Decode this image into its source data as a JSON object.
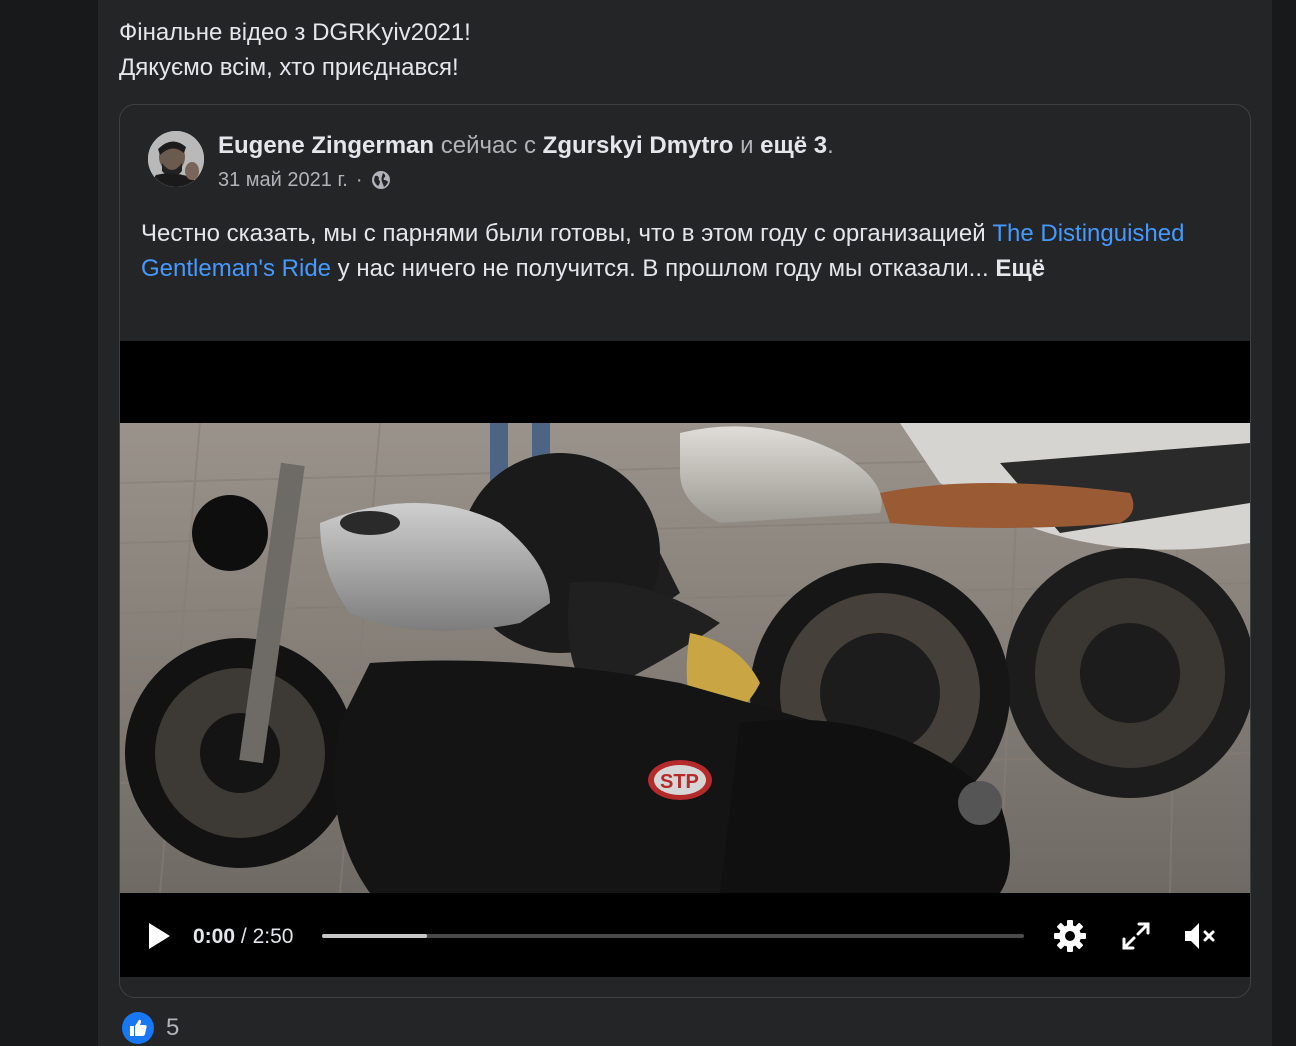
{
  "post": {
    "caption_line1": "Фінальне відео з DGRKyiv2021!",
    "caption_line2": "Дякуємо всім, хто приєднався!",
    "reaction_count": "5"
  },
  "shared_post": {
    "author": "Eugene Zingerman",
    "activity": "сейчас с",
    "tagged": "Zgurskyi Dmytro",
    "and_word": "и",
    "others": "ещё 3",
    "period": ".",
    "date": "31 май 2021 г.",
    "separator": "·",
    "privacy_icon": "globe-icon",
    "text_before_link": "Честно сказать, мы с парнями были готовы, что в этом году с организацией ",
    "link_text": "The Distinguished Gentleman's Ride",
    "text_after_link": " у нас ничего не получится. В прошлом году мы отказали...",
    "more_label": "Ещё"
  },
  "video": {
    "current_time": "0:00",
    "time_separator": "/",
    "duration": "2:50",
    "buffered_fraction": 0.15,
    "icons": [
      "play-icon",
      "settings-icon",
      "fullscreen-icon",
      "muted-speaker-icon"
    ]
  },
  "colors": {
    "page_bg": "#18191a",
    "card_bg": "#242526",
    "text_primary": "#e4e6eb",
    "text_secondary": "#b0b3b8",
    "link": "#4599ff",
    "like_blue": "#1877f2"
  }
}
